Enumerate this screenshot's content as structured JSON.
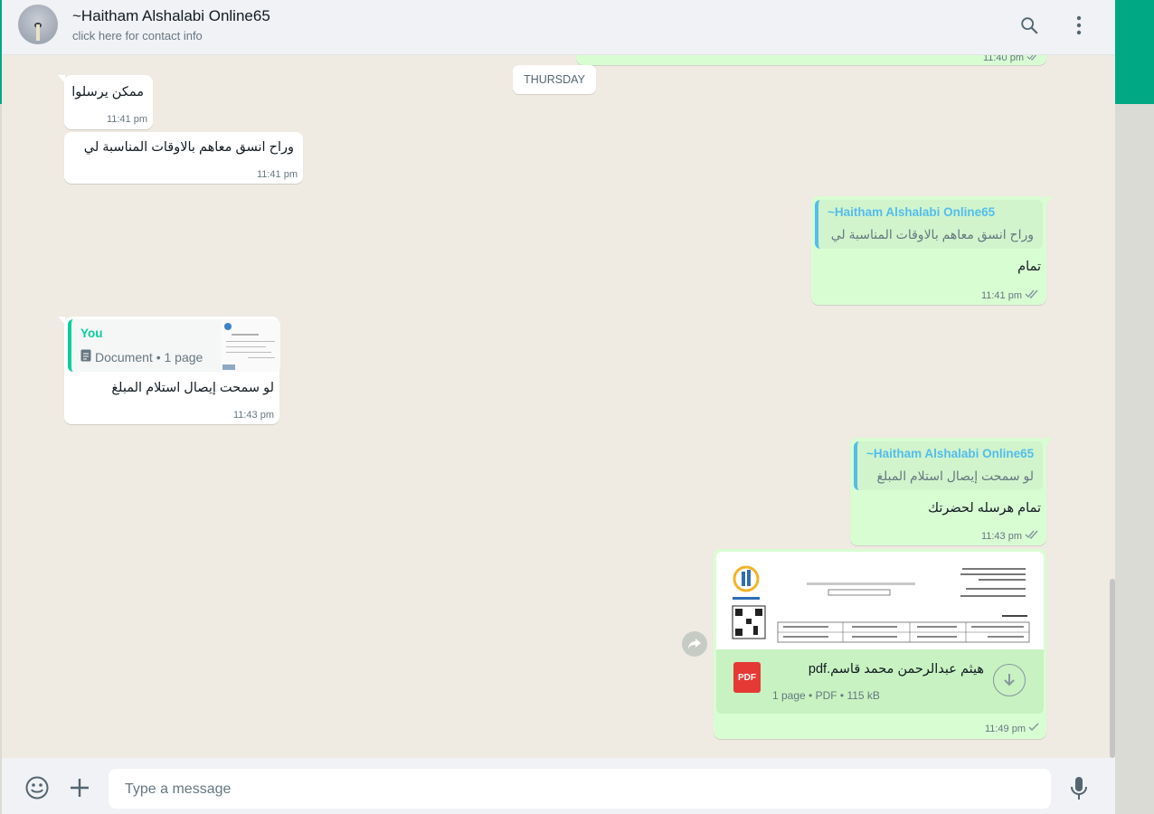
{
  "header": {
    "contact_name": "~Haitham Alshalabi Online65",
    "subtitle": "click here for contact info",
    "search_icon": "search-icon",
    "menu_icon": "more-vertical-icon"
  },
  "date_divider": "THURSDAY",
  "messages": [
    {
      "direction": "out",
      "time": "11:40 pm",
      "partial": true
    },
    {
      "direction": "in",
      "text": "ممكن يرسلوا",
      "time": "11:41 pm"
    },
    {
      "direction": "in",
      "text": "وراح انسق معاهم بالاوقات المناسبة لي",
      "time": "11:41 pm"
    },
    {
      "direction": "out",
      "quoted_name": "~Haitham Alshalabi Online65",
      "quoted_text": "وراح انسق معاهم بالاوقات المناسبة لي",
      "text": "تمام",
      "time": "11:41 pm"
    },
    {
      "direction": "in",
      "quoted_name": "You",
      "quoted_text": "Document • 1 page",
      "text": "لو سمحت إيصال استلام المبلغ",
      "time": "11:43 pm"
    },
    {
      "direction": "out",
      "quoted_name": "~Haitham Alshalabi Online65",
      "quoted_text": "لو سمحت إيصال استلام المبلغ",
      "text": "تمام هرسله لحضرتك",
      "time": "11:43 pm"
    },
    {
      "direction": "out",
      "type": "document",
      "file_name": "هيثم عبدالرحمن محمد قاسم.pdf",
      "file_meta": "1 page • PDF • 115 kB",
      "file_badge": "PDF",
      "time": "11:49 pm"
    }
  ],
  "composer": {
    "placeholder": "Type a message",
    "emoji_icon": "emoji-icon",
    "attach_icon": "plus-icon",
    "mic_icon": "microphone-icon"
  },
  "colors": {
    "outgoing_bubble": "#d9fdd3",
    "incoming_bubble": "#ffffff",
    "accent": "#00a884",
    "quote_name_color": "#53bdeb",
    "you_name_color": "#06cf9c",
    "ticks": "#8696a0"
  }
}
